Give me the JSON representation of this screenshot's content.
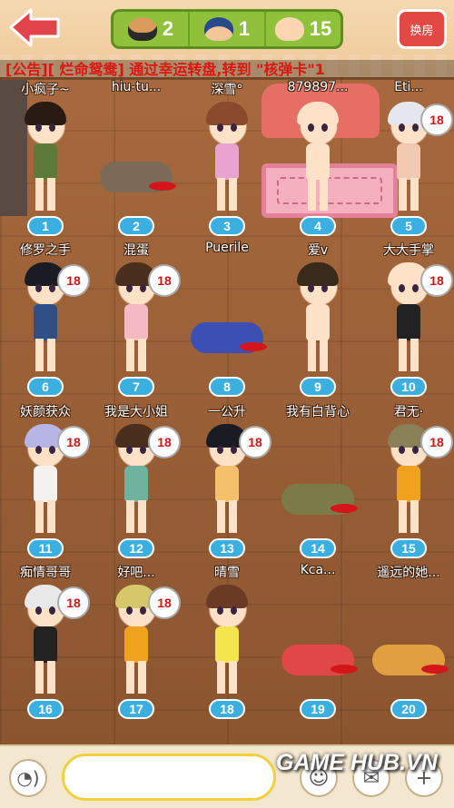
{
  "topbar": {
    "stats": [
      {
        "icon": "bandit-face-icon",
        "count": "2"
      },
      {
        "icon": "police-face-icon",
        "count": "1"
      },
      {
        "icon": "plain-face-icon",
        "count": "15"
      }
    ],
    "switch_room_label": "换房"
  },
  "ticker": "[公告][ 烂命鸳鸯] 通过幸运转盘,转到 \"核弹卡\"1",
  "seats": [
    {
      "number": "1",
      "name": "小疯子~",
      "state": "standing",
      "hair": "#2a1a14",
      "shirt": "#5e7a3a",
      "hand": false
    },
    {
      "number": "2",
      "name": "hiu-tu...",
      "state": "fallen",
      "hair": "#5a4030",
      "shirt": "#7b6a58",
      "hand": false
    },
    {
      "number": "3",
      "name": "深雪°",
      "state": "standing",
      "hair": "#8a4a2c",
      "shirt": "#e8a3cf",
      "hand": false
    },
    {
      "number": "4",
      "name": "879897...",
      "state": "standing",
      "hair": "#fde2c8",
      "shirt": "#fde2c8",
      "hand": false
    },
    {
      "number": "5",
      "name": "Eti...",
      "state": "standing",
      "hair": "#e6e6ee",
      "shirt": "#f2c9b0",
      "hand": true
    },
    {
      "number": "6",
      "name": "修罗之手",
      "state": "standing",
      "hair": "#1b1b24",
      "shirt": "#2f4f86",
      "hand": true
    },
    {
      "number": "7",
      "name": "混蛋",
      "state": "standing",
      "hair": "#4a2e1e",
      "shirt": "#f5b9c4",
      "hand": true
    },
    {
      "number": "8",
      "name": "Puerile",
      "state": "fallen",
      "hair": "#2b3fa0",
      "shirt": "#3b4fb5",
      "hand": false
    },
    {
      "number": "9",
      "name": "爱v",
      "state": "standing",
      "hair": "#3a2a1a",
      "shirt": "#fde2c8",
      "hand": false
    },
    {
      "number": "10",
      "name": "大大手掌",
      "state": "standing",
      "hair": "#fde2c8",
      "shirt": "#222222",
      "hand": true
    },
    {
      "number": "11",
      "name": "妖颜获众",
      "state": "standing",
      "hair": "#b7b5e6",
      "shirt": "#f4f1f1",
      "hand": true
    },
    {
      "number": "12",
      "name": "我是大小姐",
      "state": "standing",
      "hair": "#4a2e1e",
      "shirt": "#6fb2a0",
      "hand": true
    },
    {
      "number": "13",
      "name": "一公升",
      "state": "standing",
      "hair": "#1b1b24",
      "shirt": "#f5c06b",
      "hand": true
    },
    {
      "number": "14",
      "name": "我有白背心",
      "state": "fallen",
      "hair": "#6a5a3a",
      "shirt": "#7b7a48",
      "hand": false
    },
    {
      "number": "15",
      "name": "君无·",
      "state": "standing",
      "hair": "#8a8058",
      "shirt": "#f0a21e",
      "hand": true
    },
    {
      "number": "16",
      "name": "痴情哥哥",
      "state": "standing",
      "hair": "#e8e8e8",
      "shirt": "#222222",
      "hand": true
    },
    {
      "number": "17",
      "name": "好吧...",
      "state": "standing",
      "hair": "#d6c86a",
      "shirt": "#f0a21e",
      "hand": true
    },
    {
      "number": "18",
      "name": "晴雪",
      "state": "standing",
      "hair": "#6a3a24",
      "shirt": "#f4e64a",
      "hand": false
    },
    {
      "number": "19",
      "name": "Kca...",
      "state": "fallen",
      "hair": "#cfd7e0",
      "shirt": "#e04848",
      "hand": false
    },
    {
      "number": "20",
      "name": "遥远的她...",
      "state": "fallen",
      "hair": "#e0a040",
      "shirt": "#e0a040",
      "hand": false
    }
  ],
  "hand_label": "18",
  "chat": {
    "placeholder": ""
  },
  "watermark": "GAME HUB.VN"
}
